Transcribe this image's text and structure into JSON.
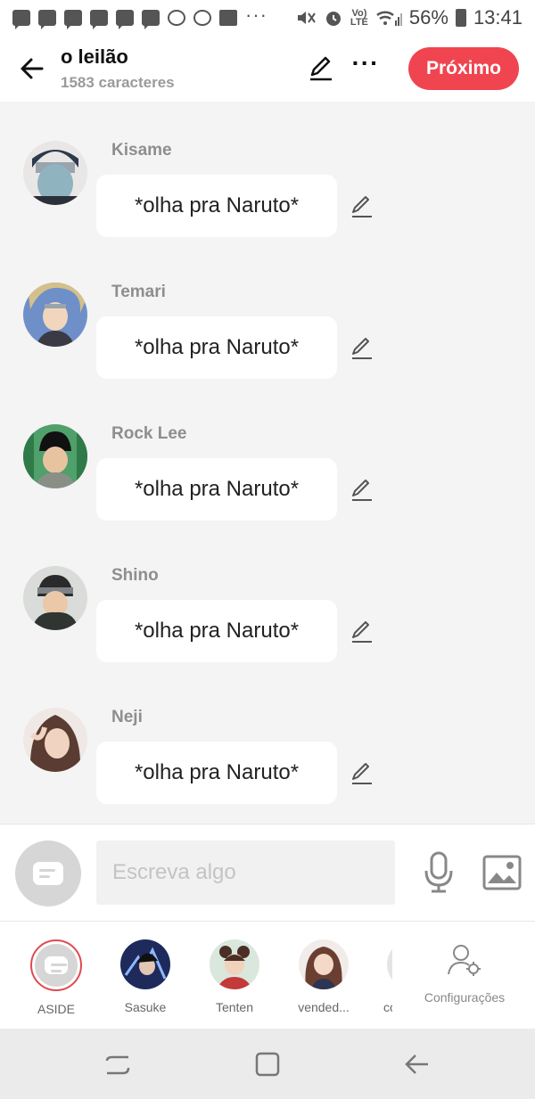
{
  "status_bar": {
    "volte": "Vo)\nLTE",
    "battery": "56%",
    "time": "13:41"
  },
  "header": {
    "title": "o leilão",
    "subtitle": "1583 caracteres",
    "next_label": "Próximo"
  },
  "messages": [
    {
      "name": "Kisame",
      "text": "*olha pra Naruto*"
    },
    {
      "name": "Temari",
      "text": "*olha pra Naruto*"
    },
    {
      "name": "Rock Lee",
      "text": "*olha pra Naruto*"
    },
    {
      "name": "Shino",
      "text": "*olha pra Naruto*"
    },
    {
      "name": "Neji",
      "text": "*olha pra Naruto*"
    }
  ],
  "input": {
    "placeholder": "Escreva algo"
  },
  "tray": {
    "items": [
      {
        "label": "ASIDE"
      },
      {
        "label": "Sasuke"
      },
      {
        "label": "Tenten"
      },
      {
        "label": "vended..."
      },
      {
        "label": "co"
      }
    ],
    "settings_label": "Configurações"
  },
  "colors": {
    "accent": "#f04550",
    "background": "#f4f4f4"
  }
}
